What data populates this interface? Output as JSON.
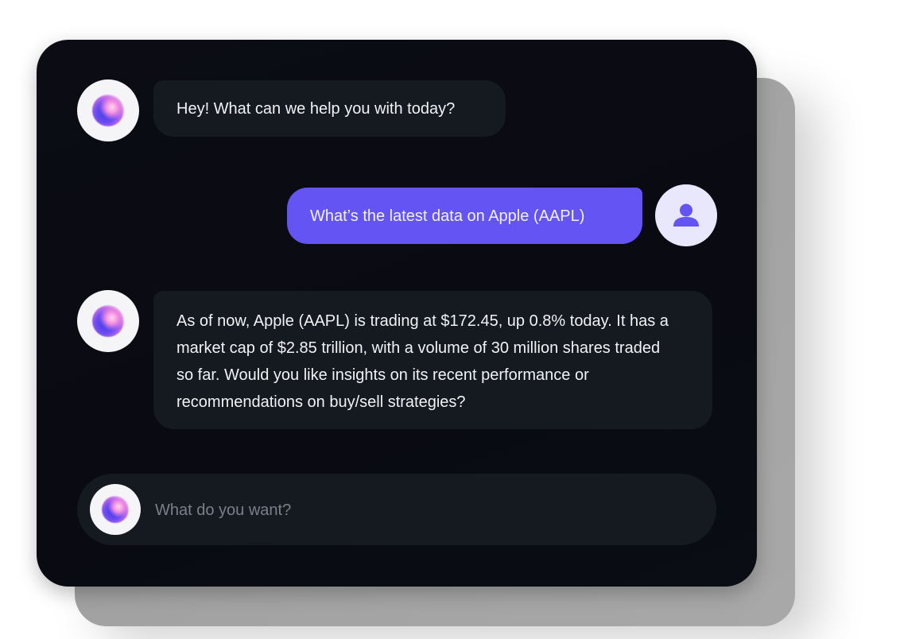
{
  "conversation": {
    "messages": [
      {
        "role": "bot",
        "text": "Hey! What can we help you with today?"
      },
      {
        "role": "user",
        "text": "What’s the latest data on Apple (AAPL)"
      },
      {
        "role": "bot",
        "text": "As of now, Apple (AAPL) is trading at $172.45, up 0.8% today. It has a market cap of $2.85 trillion, with a volume of 30 million shares traded so far. Would you like insights on its recent performance or recommendations on buy/sell strategies?"
      }
    ]
  },
  "composer": {
    "placeholder": "What do you want?",
    "value": ""
  },
  "icons": {
    "bot_avatar": "gradient-orb-icon",
    "user_avatar": "user-silhouette-icon"
  },
  "colors": {
    "card_background": "#0b0c14",
    "bot_bubble": "#141a1f",
    "user_bubble": "#6454f4",
    "user_avatar_bg": "#e8e7fb",
    "user_icon": "#6454f4"
  }
}
